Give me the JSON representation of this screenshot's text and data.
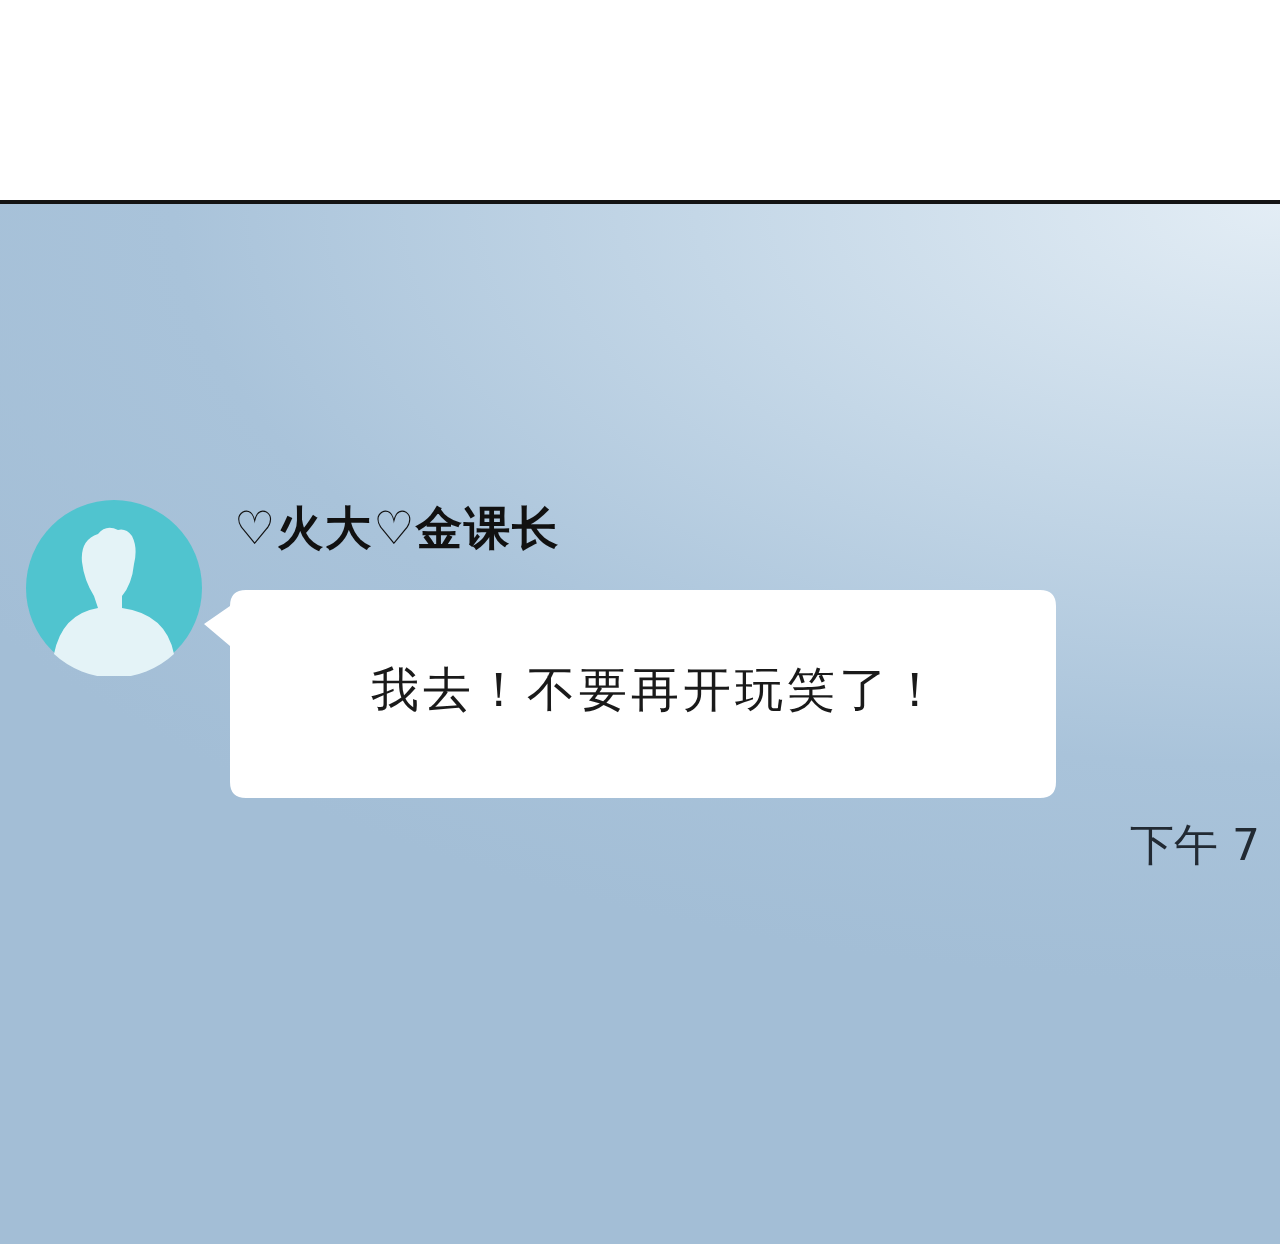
{
  "chat": {
    "contact": {
      "name": "♡火大♡金课长"
    },
    "message": {
      "text": "我去！不要再开玩笑了！",
      "time": "下午 7"
    }
  }
}
